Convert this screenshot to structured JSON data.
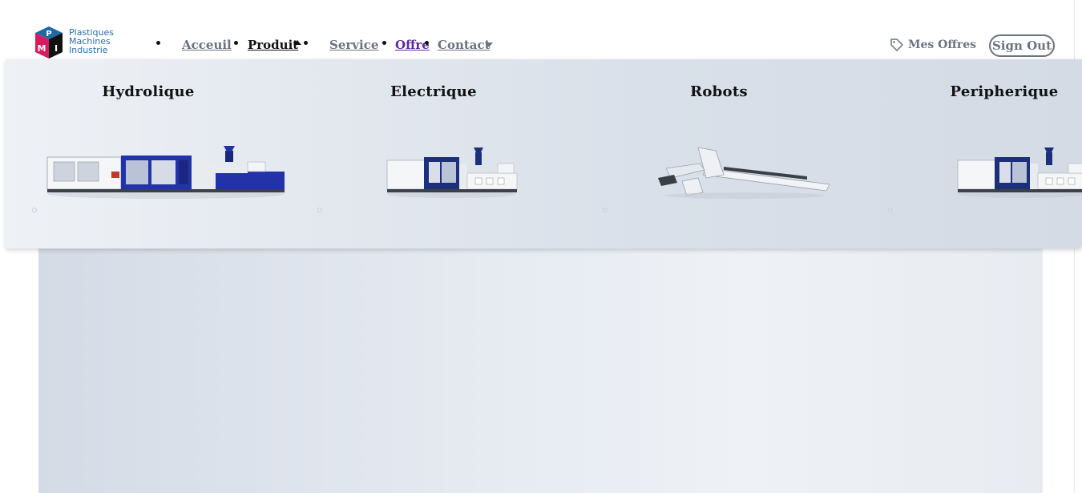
{
  "brand": {
    "line1": "Plastiques",
    "line2": "Machines",
    "line3": "Industrie",
    "logo_letters": [
      "P",
      "M",
      "I"
    ]
  },
  "nav": {
    "items": [
      {
        "label": "Acceuil",
        "state": "normal"
      },
      {
        "label": "Produit",
        "state": "active",
        "caret": "up"
      },
      {
        "label": "Service",
        "state": "normal"
      },
      {
        "label": "Offre",
        "state": "visited"
      },
      {
        "label": "Contact",
        "state": "normal",
        "caret": "down"
      }
    ]
  },
  "header_right": {
    "offers_label": "Mes Offres",
    "offers_icon": "tag-icon",
    "signout_label": "Sign Out"
  },
  "dropdown": {
    "categories": [
      {
        "title": "Hydrolique",
        "image": "hydraulic-injection-machine"
      },
      {
        "title": "Electrique",
        "image": "electric-injection-machine"
      },
      {
        "title": "Robots",
        "image": "robot-arm"
      },
      {
        "title": "Peripherique",
        "image": "peripheral-machine"
      }
    ]
  },
  "colors": {
    "nav_text": "#6b7280",
    "nav_active": "#111111",
    "nav_visited": "#5b2aa0",
    "logo_blue": "#1f6aa5",
    "logo_magenta": "#d81b60",
    "machine_navy": "#1c2f7a",
    "machine_blue": "#2233aa"
  }
}
